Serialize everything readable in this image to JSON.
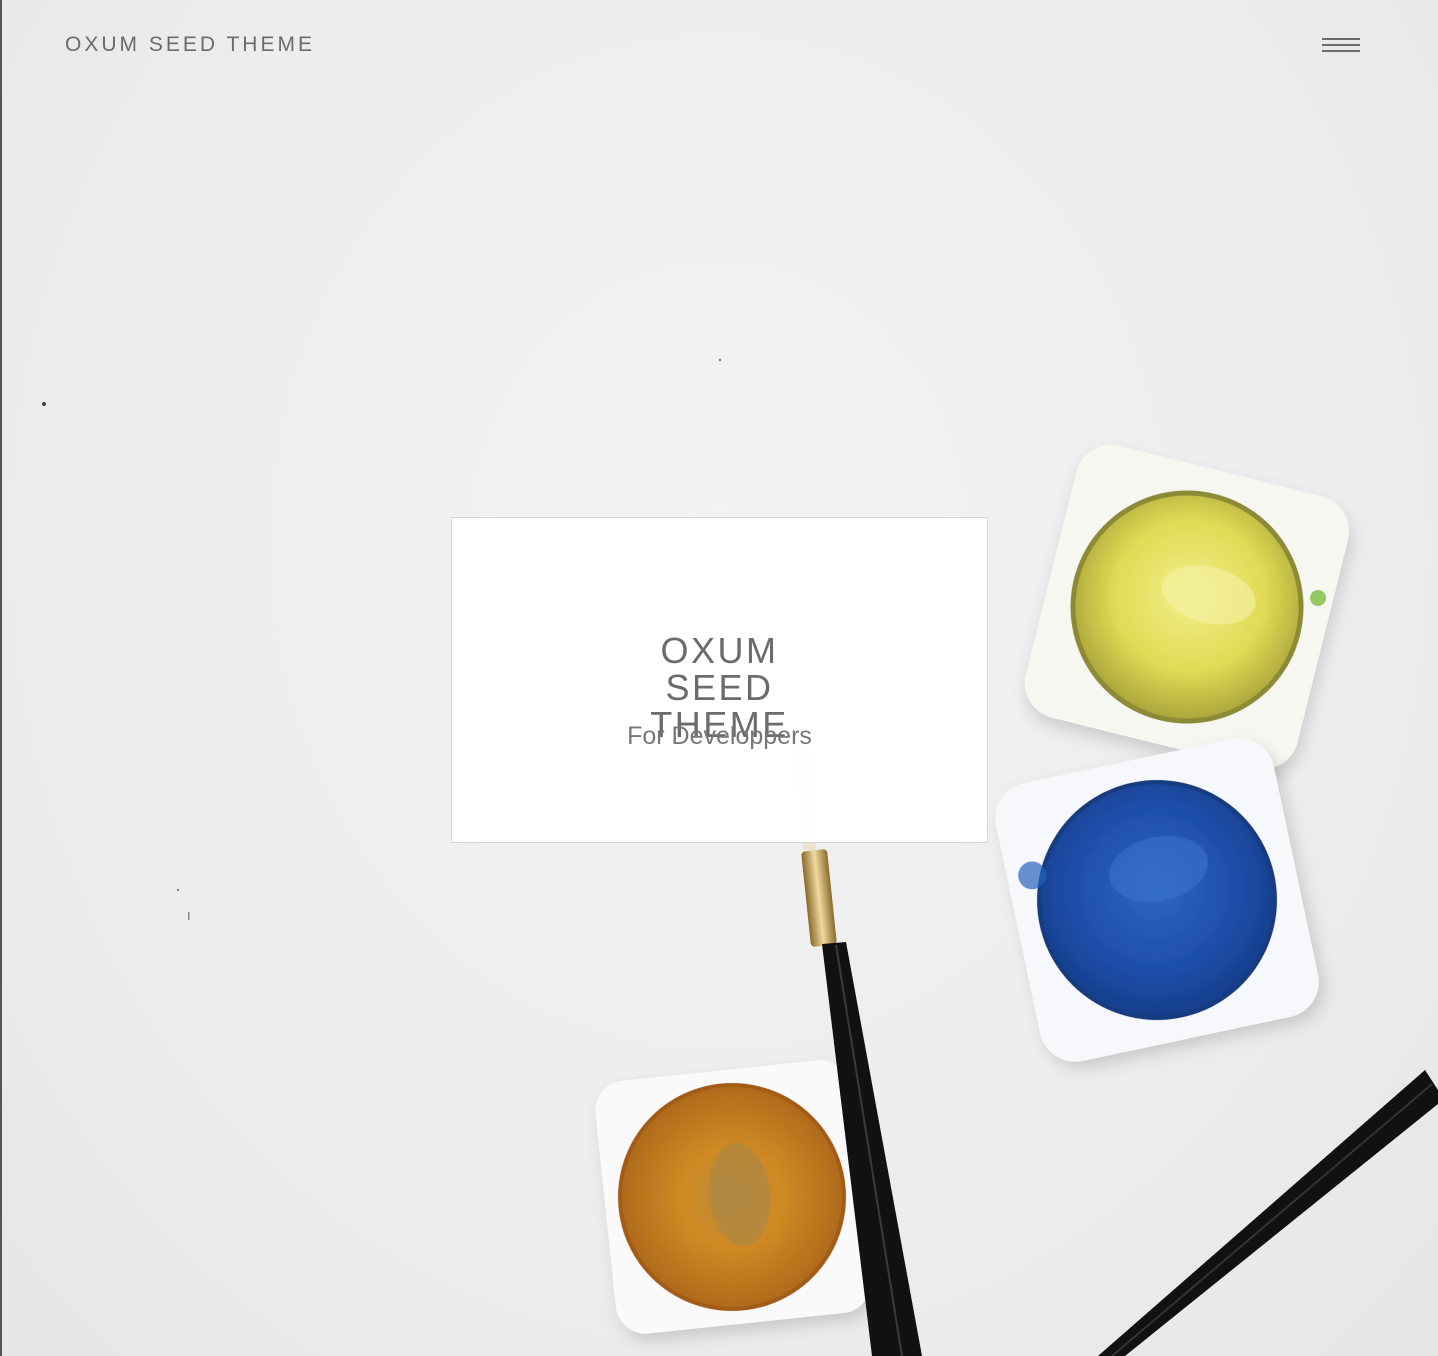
{
  "header": {
    "brand": "OXUM SEED THEME",
    "menu_icon": "hamburger-menu-icon"
  },
  "hero": {
    "title": "OXUM SEED THEME",
    "subtitle": "For Developpers",
    "background_image": "watercolor-paints-and-brushes",
    "colors": {
      "text": "#6b6b6b",
      "paint_yellow": "#d8d44a",
      "paint_blue": "#1e4fa8",
      "paint_orange": "#c9821f"
    }
  }
}
